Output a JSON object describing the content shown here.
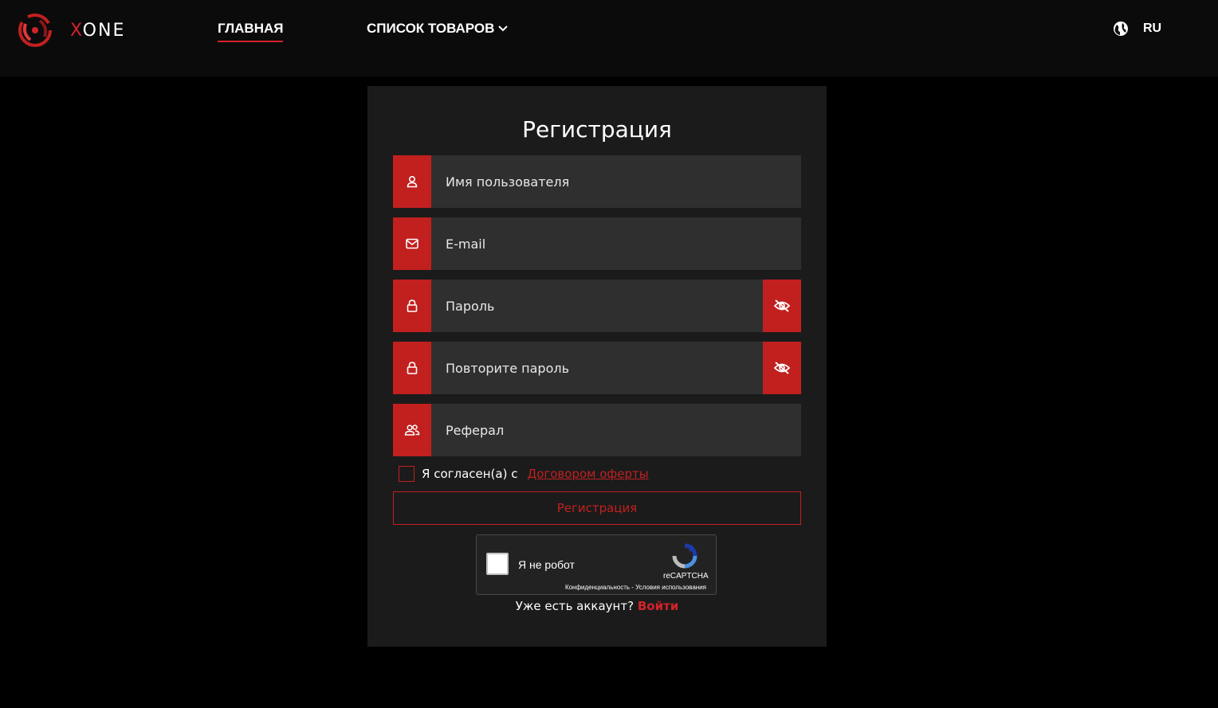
{
  "header": {
    "logo_text_accent": "X",
    "logo_text_rest": "ONE",
    "nav": {
      "home": "ГЛАВНАЯ",
      "products": "СПИСОК ТОВАРОВ"
    },
    "language": "RU",
    "accent_color": "#d2232a"
  },
  "form": {
    "title": "Регистрация",
    "fields": [
      {
        "placeholder": "Имя пользователя",
        "icon": "user-icon"
      },
      {
        "placeholder": "E-mail",
        "icon": "mail-icon"
      },
      {
        "placeholder": "Пароль",
        "icon": "lock-icon",
        "toggle_icon": "eye-slash-icon"
      },
      {
        "placeholder": "Повторите пароль",
        "icon": "lock-icon",
        "toggle_icon": "eye-slash-icon"
      },
      {
        "placeholder": "Реферал",
        "icon": "users-icon"
      }
    ],
    "agree_text": "Я согласен(а) с",
    "agree_link": "Договором оферты",
    "submit_label": "Регистрация",
    "recaptcha": {
      "label": "Я не робот",
      "brand": "reCAPTCHA",
      "links": "Конфиденциальность - Условия использования"
    },
    "login_prompt": "Уже есть аккаунт?",
    "login_link": "Войти"
  }
}
